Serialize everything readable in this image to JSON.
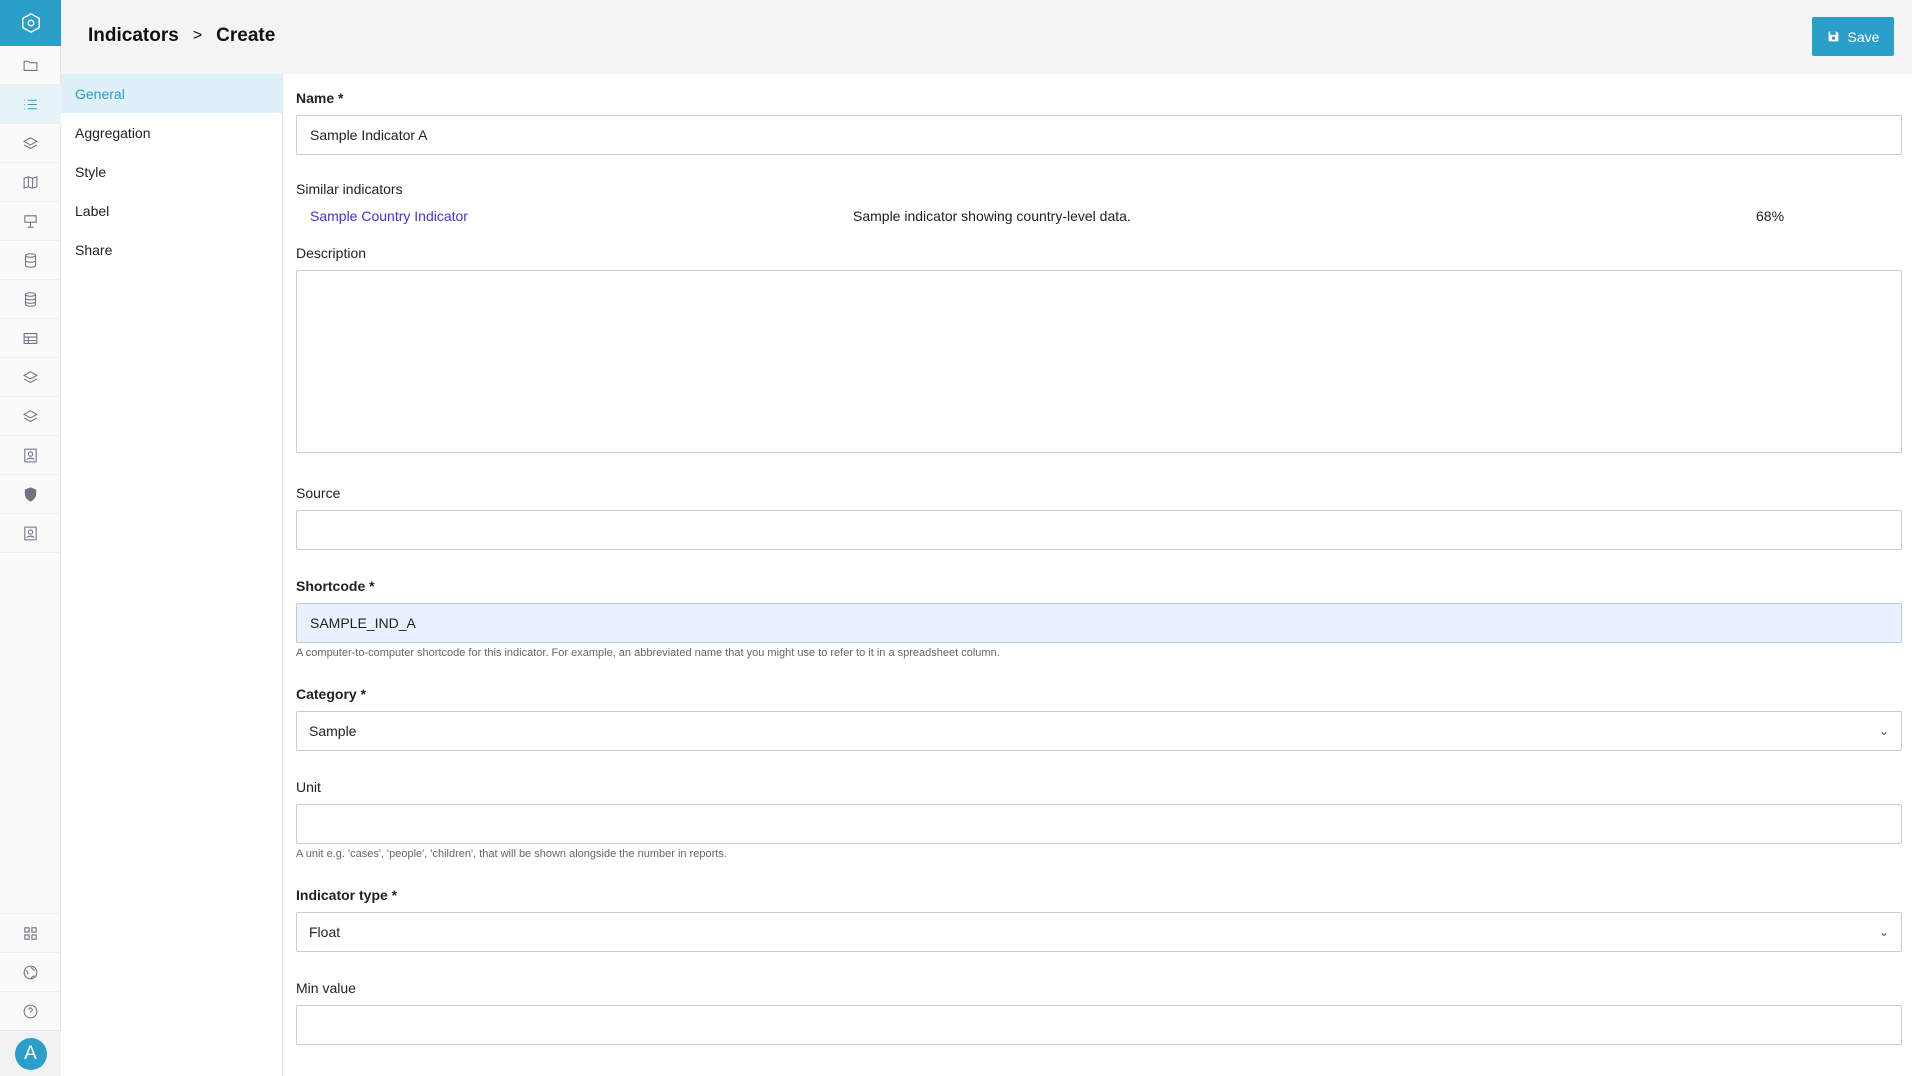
{
  "header": {
    "breadcrumb": [
      "Indicators",
      "Create"
    ],
    "separator": ">",
    "save_label": "Save"
  },
  "rail": {
    "logo_icon": "hexagon-logo-icon",
    "items": [
      "folder-icon",
      "list-icon",
      "layers-icon",
      "map-icon",
      "presentation-icon",
      "database-icon",
      "database-icon",
      "table-icon",
      "layers-icon",
      "layers-icon",
      "contact-icon",
      "shield-icon",
      "contact-icon"
    ],
    "bottom_items": [
      "grid-icon",
      "globe-icon",
      "help-icon"
    ],
    "avatar_letter": "A",
    "accent": "#2a9fc9"
  },
  "sections": {
    "items": [
      "General",
      "Aggregation",
      "Style",
      "Label",
      "Share"
    ],
    "active": "General"
  },
  "form": {
    "name": {
      "label": "Name *",
      "value": "Sample Indicator A"
    },
    "similar": {
      "label": "Similar indicators",
      "rows": [
        {
          "name": "Sample Country Indicator",
          "description": "Sample indicator showing country-level data.",
          "score": "68%"
        }
      ]
    },
    "description": {
      "label": "Description",
      "value": ""
    },
    "source": {
      "label": "Source",
      "value": ""
    },
    "shortcode": {
      "label": "Shortcode *",
      "value": "SAMPLE_IND_A",
      "hint": "A computer-to-computer shortcode for this indicator. For example, an abbreviated name that you might use to refer to it in a spreadsheet column."
    },
    "category": {
      "label": "Category *",
      "value": "Sample"
    },
    "unit": {
      "label": "Unit",
      "value": "",
      "hint": "A unit e.g. 'cases', 'people', 'children', that will be shown alongside the number in reports."
    },
    "indicator_type": {
      "label": "Indicator type *",
      "value": "Float"
    },
    "min_value": {
      "label": "Min value",
      "value": ""
    }
  }
}
